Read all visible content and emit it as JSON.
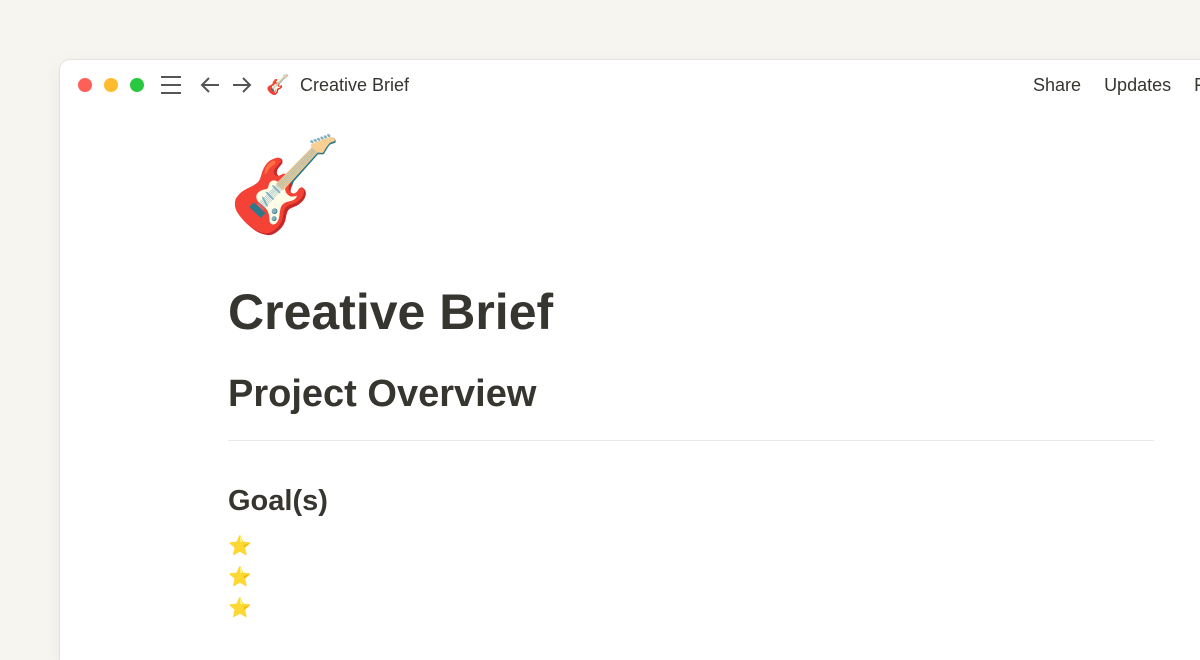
{
  "window": {
    "breadcrumb": {
      "icon": "🎸",
      "title": "Creative Brief"
    },
    "actions": [
      "Share",
      "Updates",
      "F"
    ],
    "icons": [
      "menu-icon",
      "back-arrow-icon",
      "forward-arrow-icon"
    ]
  },
  "page": {
    "icon": "🎸",
    "title": "Creative Brief",
    "heading": "Project Overview",
    "subheading": "Goal(s)",
    "list_items": [
      "⭐",
      "⭐",
      "⭐"
    ]
  }
}
